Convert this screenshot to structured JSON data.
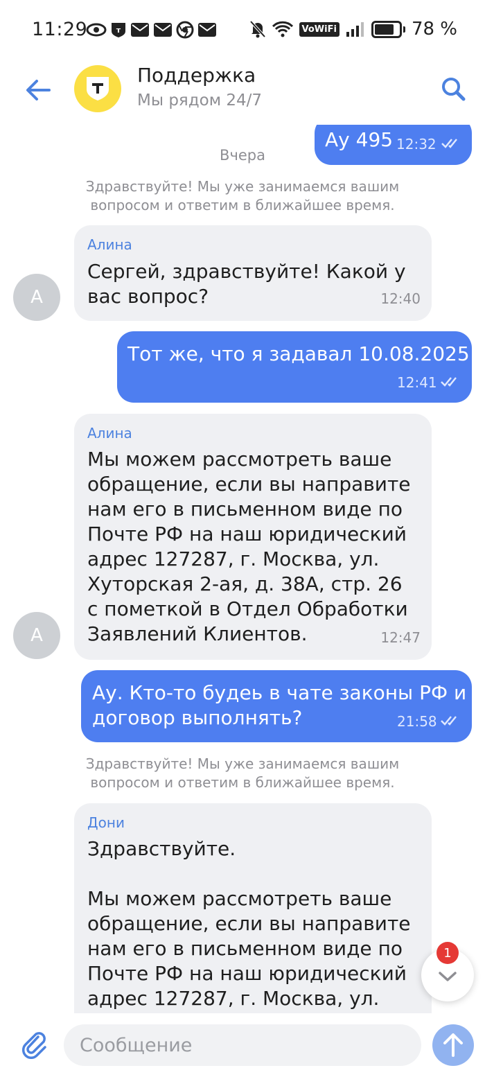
{
  "status_bar": {
    "time": "11:29",
    "network_badge": "VoWiFi",
    "battery": "78 %"
  },
  "header": {
    "title": "Поддержка",
    "subtitle": "Мы рядом 24/7",
    "logo_letter": "т"
  },
  "messages": {
    "m0": {
      "text": "Ау 495",
      "time": "12:32"
    },
    "day_separator": "Вчера",
    "system1": "Здравствуйте! Мы уже занимаемся вашим\nвопросом и ответим в ближайшее время.",
    "m1": {
      "sender": "Алина",
      "text": "Сергей, здравствуйте! Какой у\nвас вопрос?",
      "time": "12:40",
      "avatar": "А"
    },
    "m2": {
      "text": "Тот же, что я задавал 10.08.2025",
      "time": "12:41"
    },
    "m3": {
      "sender": "Алина",
      "text": "Мы можем рассмотреть ваше\nобращение, если вы направите\nнам его в письменном виде по\nПочте РФ на наш юридический\nадрес 127287, г. Москва, ул.\nХуторская 2-ая, д. 38А, стр. 26\nс пометкой в Отдел Обработки\nЗаявлений Клиентов.",
      "time": "12:47",
      "avatar": "А"
    },
    "m4": {
      "text": "Ау. Кто-то будеь в чате законы РФ и\nдоговор выполнять?",
      "time": "21:58"
    },
    "system2": "Здравствуйте! Мы уже занимаемся вашим\nвопросом и ответим в ближайшее время.",
    "m5": {
      "sender": "Дони",
      "text": "Здравствуйте.\n\nМы можем рассмотреть ваше\nобращение, если вы направите\nнам его в письменном виде по\nПочте РФ на наш юридический\nадрес 127287, г. Москва, ул."
    }
  },
  "scroll_badge": "1",
  "composer": {
    "placeholder": "Сообщение"
  },
  "colors": {
    "accent": "#4e7ef0",
    "incoming": "#eff0f3",
    "logo": "#fbdf44",
    "badge": "#e53935"
  }
}
